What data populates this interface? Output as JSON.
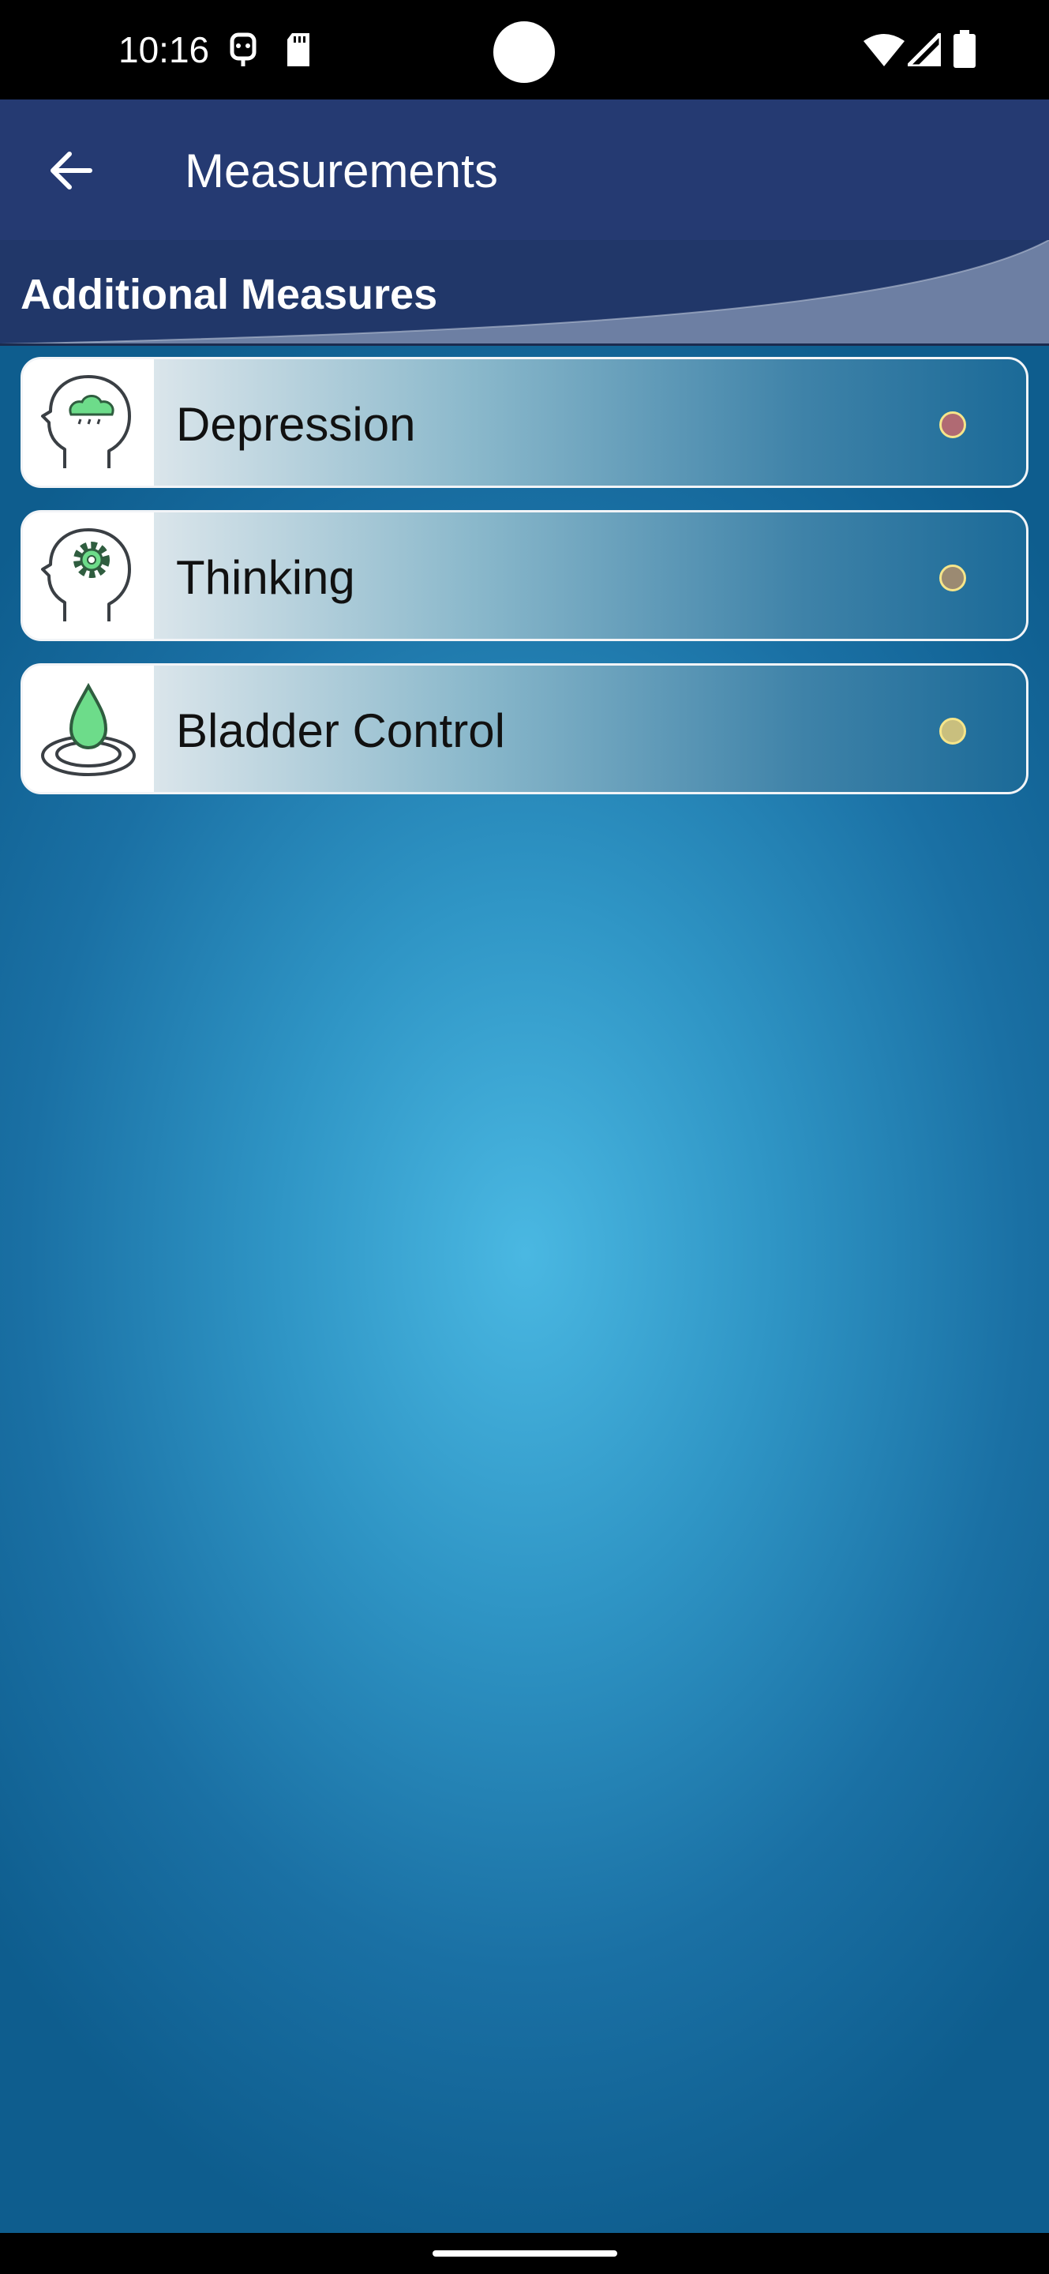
{
  "status_bar": {
    "time": "10:16",
    "icons": [
      "assistant-icon",
      "sd-card-icon",
      "wifi-icon",
      "signal-icon",
      "battery-icon"
    ]
  },
  "app_bar": {
    "title": "Measurements",
    "back_icon": "arrow-back-icon"
  },
  "section": {
    "title": "Additional Measures"
  },
  "items": [
    {
      "label": "Depression",
      "icon": "head-cloud-icon",
      "status_color": "#b06a73"
    },
    {
      "label": "Thinking",
      "icon": "head-gear-icon",
      "status_color": "#9b8a72"
    },
    {
      "label": "Bladder Control",
      "icon": "water-drop-icon",
      "status_color": "#c9bf7e"
    }
  ],
  "colors": {
    "app_bar": "#253a72",
    "accent_green": "#6ddc8a"
  }
}
